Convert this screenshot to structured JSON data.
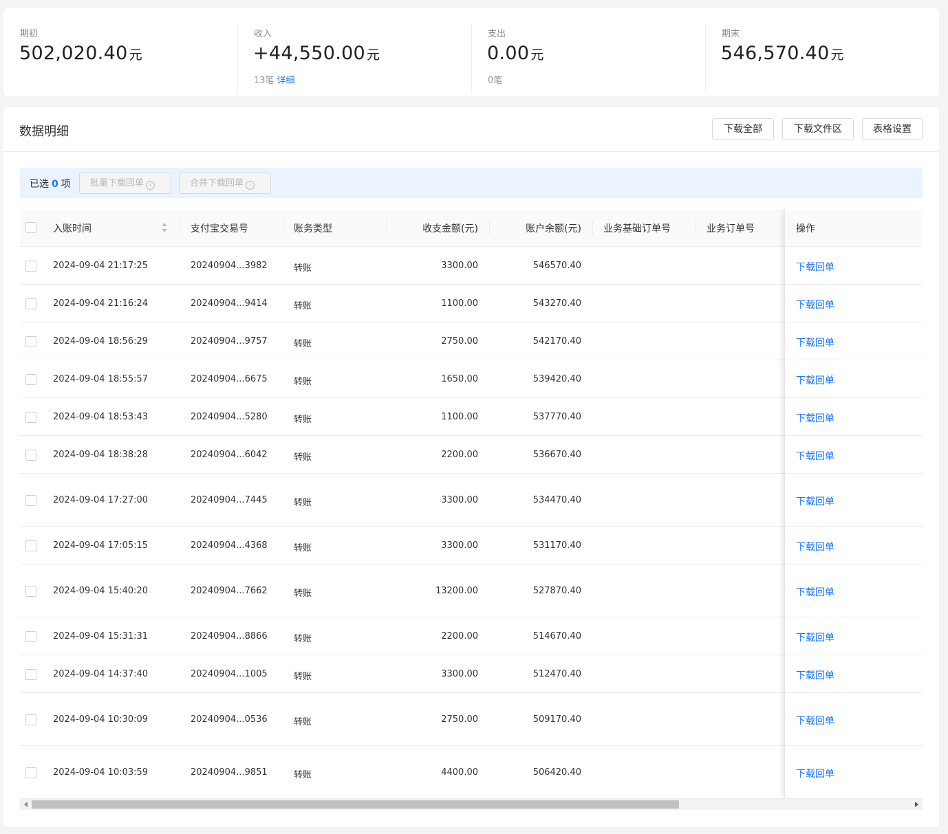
{
  "summary": [
    {
      "label": "期初",
      "value": "502,020.40",
      "unit": "元",
      "sub_text": "",
      "sub_link": ""
    },
    {
      "label": "收入",
      "value": "+44,550.00",
      "unit": "元",
      "sub_text": "13笔",
      "sub_link": "详细"
    },
    {
      "label": "支出",
      "value": "0.00",
      "unit": "元",
      "sub_text": "0笔",
      "sub_link": ""
    },
    {
      "label": "期末",
      "value": "546,570.40",
      "unit": "元",
      "sub_text": "",
      "sub_link": ""
    }
  ],
  "detail": {
    "title": "数据明细",
    "buttons": {
      "download_all": "下载全部",
      "download_files": "下载文件区",
      "table_settings": "表格设置"
    },
    "selection": {
      "prefix": "已选",
      "count": "0",
      "suffix": "项",
      "batch_download": "批量下载回单",
      "merge_download": "合并下载回单",
      "info_glyph": "i"
    }
  },
  "table": {
    "columns": [
      "入账时间",
      "支付宝交易号",
      "账务类型",
      "收支金额(元)",
      "账户余额(元)",
      "业务基础订单号",
      "业务订单号",
      "操作"
    ],
    "rows": [
      {
        "time": "2024-09-04 21:17:25",
        "trade_no": "20240904...3982",
        "type": "转账",
        "amount": "3300.00",
        "balance": "546570.40",
        "action": "下载回单"
      },
      {
        "time": "2024-09-04 21:16:24",
        "trade_no": "20240904...9414",
        "type": "转账",
        "amount": "1100.00",
        "balance": "543270.40",
        "action": "下载回单"
      },
      {
        "time": "2024-09-04 18:56:29",
        "trade_no": "20240904...9757",
        "type": "转账",
        "amount": "2750.00",
        "balance": "542170.40",
        "action": "下载回单"
      },
      {
        "time": "2024-09-04 18:55:57",
        "trade_no": "20240904...6675",
        "type": "转账",
        "amount": "1650.00",
        "balance": "539420.40",
        "action": "下载回单"
      },
      {
        "time": "2024-09-04 18:53:43",
        "trade_no": "20240904...5280",
        "type": "转账",
        "amount": "1100.00",
        "balance": "537770.40",
        "action": "下载回单"
      },
      {
        "time": "2024-09-04 18:38:28",
        "trade_no": "20240904...6042",
        "type": "转账",
        "amount": "2200.00",
        "balance": "536670.40",
        "action": "下载回单"
      },
      {
        "time": "2024-09-04 17:27:00",
        "trade_no": "20240904...7445",
        "type": "转账",
        "amount": "3300.00",
        "balance": "534470.40",
        "action": "下载回单"
      },
      {
        "time": "2024-09-04 17:05:15",
        "trade_no": "20240904...4368",
        "type": "转账",
        "amount": "3300.00",
        "balance": "531170.40",
        "action": "下载回单"
      },
      {
        "time": "2024-09-04 15:40:20",
        "trade_no": "20240904...7662",
        "type": "转账",
        "amount": "13200.00",
        "balance": "527870.40",
        "action": "下载回单"
      },
      {
        "time": "2024-09-04 15:31:31",
        "trade_no": "20240904...8866",
        "type": "转账",
        "amount": "2200.00",
        "balance": "514670.40",
        "action": "下载回单"
      },
      {
        "time": "2024-09-04 14:37:40",
        "trade_no": "20240904...1005",
        "type": "转账",
        "amount": "3300.00",
        "balance": "512470.40",
        "action": "下载回单"
      },
      {
        "time": "2024-09-04 10:30:09",
        "trade_no": "20240904...0536",
        "type": "转账",
        "amount": "2750.00",
        "balance": "509170.40",
        "action": "下载回单"
      },
      {
        "time": "2024-09-04 10:03:59",
        "trade_no": "20240904...9851",
        "type": "转账",
        "amount": "4400.00",
        "balance": "506420.40",
        "action": "下载回单"
      }
    ]
  },
  "icons": {
    "sort": "sort-icon",
    "info": "info-icon",
    "scroll_left": "chevron-left-icon",
    "scroll_right": "chevron-right-icon"
  },
  "colors": {
    "accent": "#1677ff",
    "selection_bar": "#eaf3ff",
    "background": "#f4f4f4"
  }
}
